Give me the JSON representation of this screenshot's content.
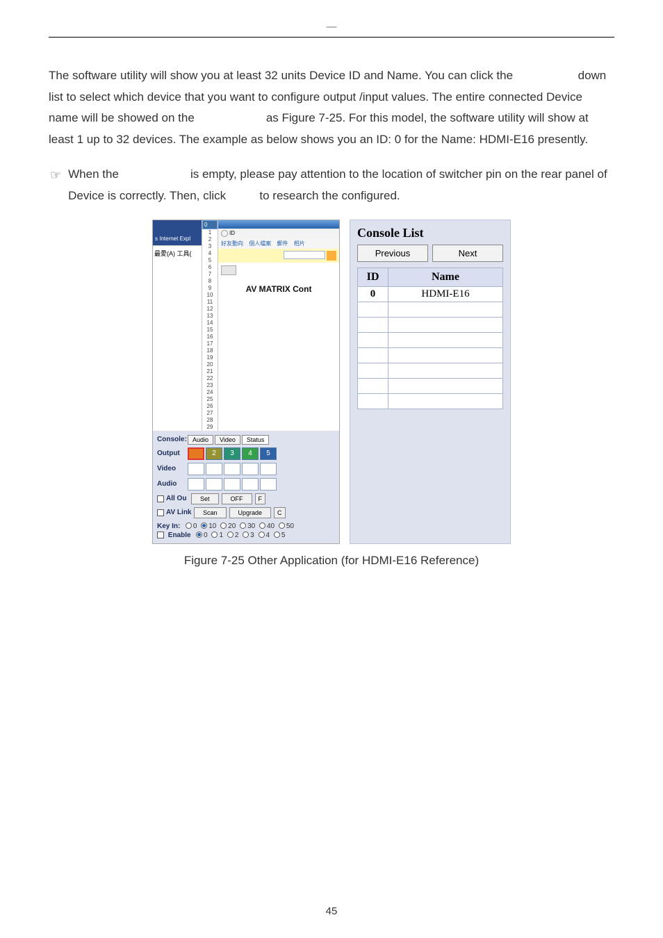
{
  "header_dash": "—",
  "para1_a": "The software utility will show you at least 32 units Device ID and Name. You can click the ",
  "para1_b": " down list to select which device that you want to configure output /input values. The entire connected Device name will be showed on the ",
  "para1_c": " as Figure 7-25. For this model, the software utility will show at least 1 up to 32 devices. The example as below shows you an ID: 0 for the Name: HDMI-E16 presently.",
  "note_bullet": "☞",
  "note_a": "When the ",
  "note_b": " is empty, please pay attention to the location of switcher pin on the rear panel of Device is correctly. Then, click ",
  "note_c": " to research the configured.",
  "caption": "Figure 7-25 Other Application (for HDMI-E16 Reference)",
  "page_number": "45",
  "left": {
    "ie_tab": "s Internet Expl",
    "menu_fav": "最愛(A)",
    "menu_tool": "工具(",
    "circle_text": "ID",
    "links": [
      "好友動向",
      "個人檔案",
      "郵件",
      "相片"
    ],
    "title": "AV MATRIX Cont",
    "labels": {
      "console": "Console:",
      "output": "Output",
      "video": "Video",
      "audio": "Audio",
      "allout": "All Ou",
      "avlink": "AV Link"
    },
    "tabs": [
      "Audio",
      "Video",
      "Status"
    ],
    "output_cells": [
      "2",
      "3",
      "4",
      "5"
    ],
    "dropdown_items": [
      "0",
      "1",
      "2",
      "3",
      "4",
      "5",
      "6",
      "7",
      "8",
      "9",
      "10",
      "11",
      "12",
      "13",
      "14",
      "15",
      "16",
      "17",
      "18",
      "19",
      "20",
      "21",
      "22",
      "23",
      "24",
      "25",
      "26",
      "27",
      "28",
      "29"
    ],
    "buttons": {
      "set": "Set",
      "off": "OFF",
      "f": "F",
      "scan": "Scan",
      "upgrade": "Upgrade",
      "c": "C"
    },
    "keyin_label": "Key In:",
    "keyin_opts": [
      "0",
      "10",
      "20",
      "30",
      "40",
      "50"
    ],
    "enable_label": "Enable",
    "enable_opts": [
      "0",
      "1",
      "2",
      "3",
      "4",
      "5"
    ]
  },
  "right": {
    "title": "Console List",
    "prev": "Previous",
    "next": "Next",
    "col_id": "ID",
    "col_name": "Name",
    "rows": [
      {
        "id": "0",
        "name": "HDMI-E16"
      },
      {
        "id": "",
        "name": ""
      },
      {
        "id": "",
        "name": ""
      },
      {
        "id": "",
        "name": ""
      },
      {
        "id": "",
        "name": ""
      },
      {
        "id": "",
        "name": ""
      },
      {
        "id": "",
        "name": ""
      },
      {
        "id": "",
        "name": ""
      }
    ]
  }
}
